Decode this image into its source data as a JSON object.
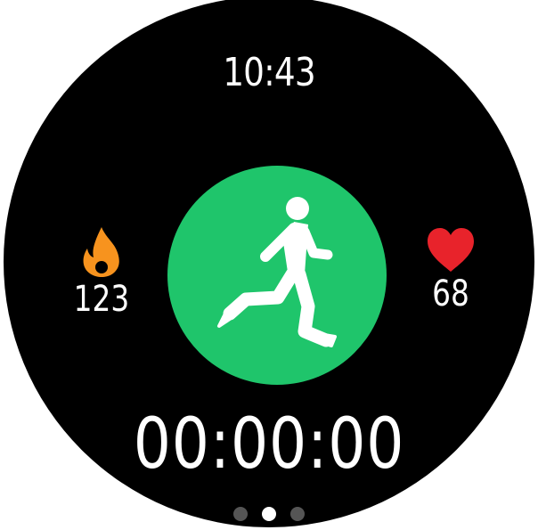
{
  "clock": {
    "time": "10:43"
  },
  "metrics": {
    "calories": {
      "value": "123",
      "icon": "flame-icon",
      "color": "#f7931e"
    },
    "heart_rate": {
      "value": "68",
      "icon": "heart-icon",
      "color": "#e8232b"
    }
  },
  "workout": {
    "activity_icon": "running-person-icon",
    "button_color": "#1fc56b",
    "timer": "00:00:00"
  },
  "pager": {
    "total": 3,
    "active_index": 1
  }
}
